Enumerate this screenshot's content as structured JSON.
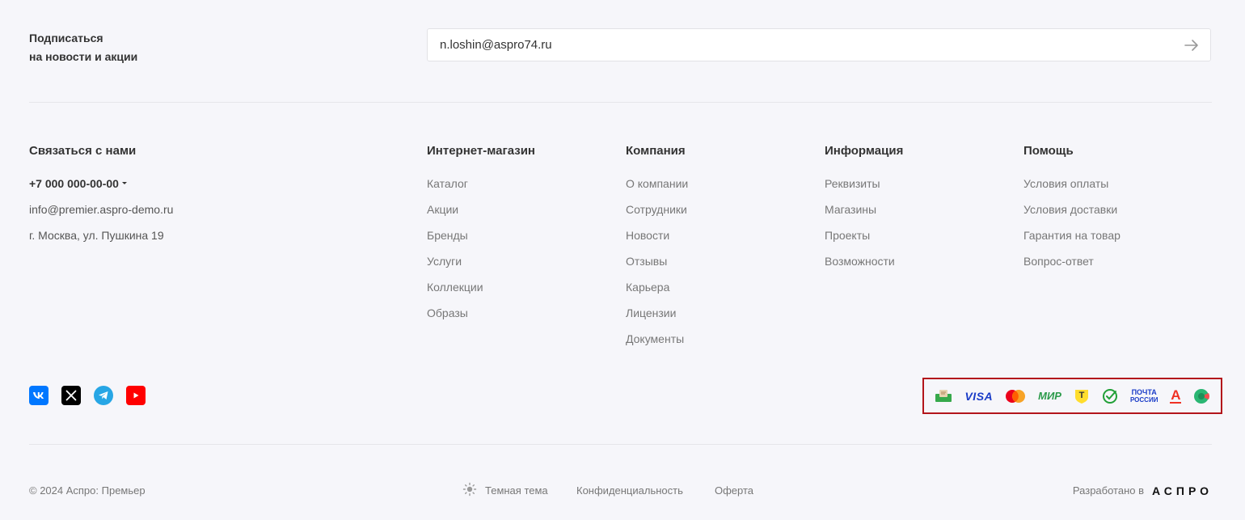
{
  "subscribe": {
    "title_line1": "Подписаться",
    "title_line2": "на новости и акции",
    "email_value": "n.loshin@aspro74.ru",
    "submit_icon": "arrow-right-icon"
  },
  "contacts": {
    "title": "Связаться с нами",
    "phone": "+7 000 000-00-00",
    "email": "info@premier.aspro-demo.ru",
    "address": "г. Москва, ул. Пушкина 19"
  },
  "columns": {
    "shop": {
      "title": "Интернет-магазин",
      "links": [
        "Каталог",
        "Акции",
        "Бренды",
        "Услуги",
        "Коллекции",
        "Образы"
      ]
    },
    "company": {
      "title": "Компания",
      "links": [
        "О компании",
        "Сотрудники",
        "Новости",
        "Отзывы",
        "Карьера",
        "Лицензии",
        "Документы"
      ]
    },
    "info": {
      "title": "Информация",
      "links": [
        "Реквизиты",
        "Магазины",
        "Проекты",
        "Возможности"
      ]
    },
    "help": {
      "title": "Помощь",
      "links": [
        "Условия оплаты",
        "Условия доставки",
        "Гарантия на товар",
        "Вопрос-ответ"
      ]
    }
  },
  "social": [
    {
      "name": "vk-icon",
      "color": "#0077ff"
    },
    {
      "name": "x-icon",
      "color": "#000000"
    },
    {
      "name": "telegram-icon",
      "color": "#27a6e5"
    },
    {
      "name": "youtube-icon",
      "color": "#ff0000"
    }
  ],
  "payments": {
    "visa_label": "VISA",
    "mir_label": "МИР",
    "pochta_line1": "ПОЧТА",
    "pochta_line2": "РОССИИ",
    "alfa_label": "А",
    "tinkoff_label": "Т"
  },
  "bottom": {
    "copyright": "© 2024 Аспро: Премьер",
    "theme_label": "Темная тема",
    "privacy_label": "Конфиденциальность",
    "offer_label": "Оферта",
    "developed_by": "Разработано в",
    "developer_logo": "АСПРО"
  },
  "colors": {
    "background": "#f6f6fa",
    "accent_frame": "#b3151b"
  }
}
